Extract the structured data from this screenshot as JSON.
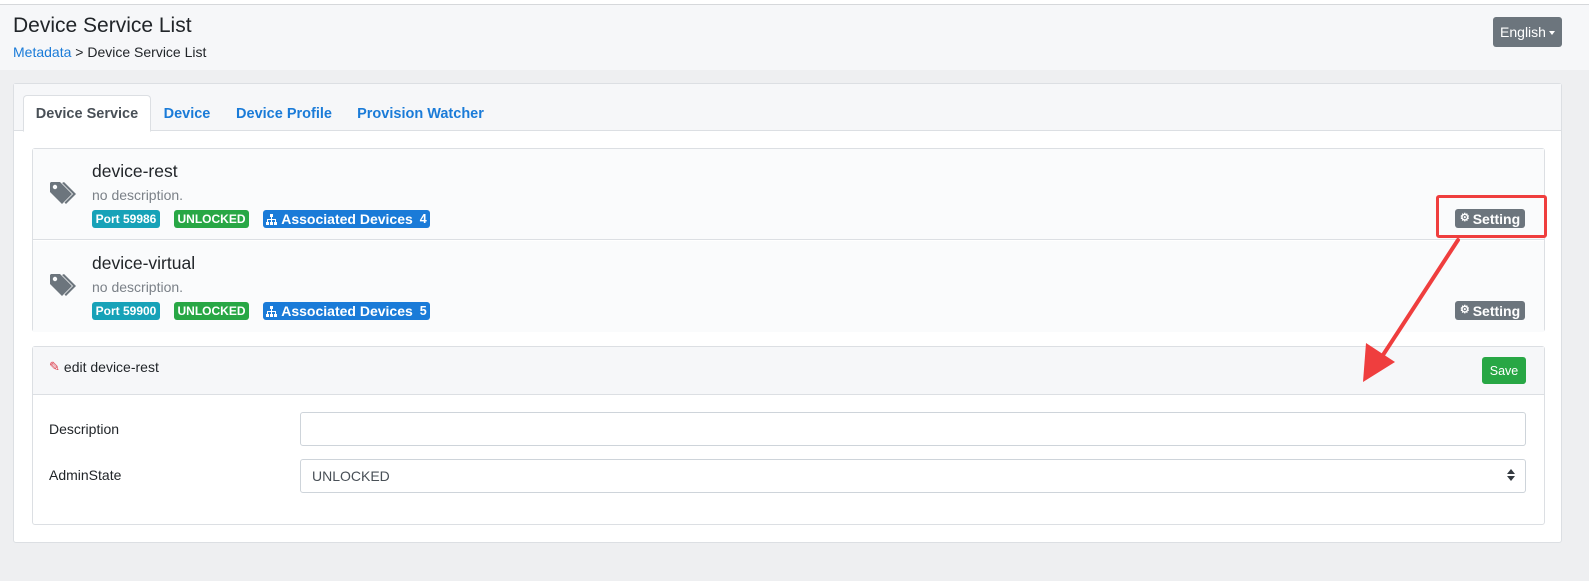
{
  "header": {
    "title": "Device Service List",
    "breadcrumb_link": "Metadata",
    "breadcrumb_separator": ">",
    "breadcrumb_current": "Device Service List",
    "language_label": "English"
  },
  "tabs": [
    {
      "label": "Device Service",
      "active": true
    },
    {
      "label": "Device",
      "active": false
    },
    {
      "label": "Device Profile",
      "active": false
    },
    {
      "label": "Provision Watcher",
      "active": false
    }
  ],
  "services": [
    {
      "name": "device-rest",
      "description": "no description.",
      "port_badge": "Port 59986",
      "state_badge": "UNLOCKED",
      "assoc_label": "Associated Devices",
      "assoc_count": "4",
      "setting_label": "Setting"
    },
    {
      "name": "device-virtual",
      "description": "no description.",
      "port_badge": "Port 59900",
      "state_badge": "UNLOCKED",
      "assoc_label": "Associated Devices",
      "assoc_count": "5",
      "setting_label": "Setting"
    }
  ],
  "edit_panel": {
    "title": "edit device-rest",
    "save_label": "Save",
    "description_label": "Description",
    "description_value": "",
    "adminstate_label": "AdminState",
    "adminstate_value": "UNLOCKED"
  },
  "colors": {
    "link": "#1a7bd8",
    "port_badge": "#17a2b8",
    "state_badge": "#28a745",
    "assoc_badge": "#1a7bd8",
    "secondary_button": "#6c757d",
    "save_button": "#28a745",
    "annotation": "#ef3e3e"
  },
  "icons": {
    "service_icon": "tags-icon",
    "assoc_icon": "sitemap-icon",
    "setting_icon": "gear-icon",
    "edit_icon": "edit-icon",
    "select_icon": "sort-arrows-icon"
  }
}
